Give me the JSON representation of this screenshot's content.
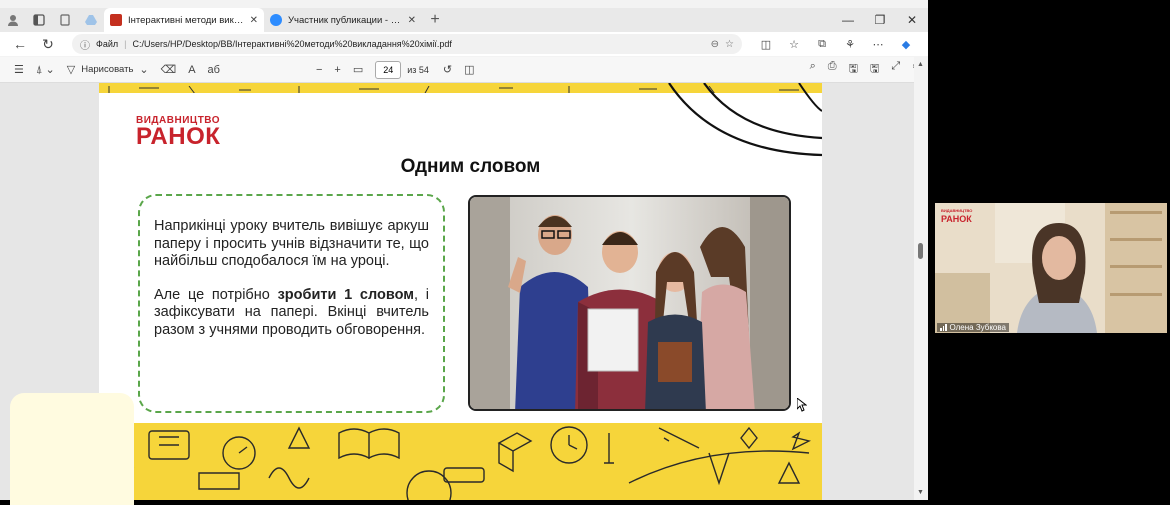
{
  "browser": {
    "tabs": [
      {
        "label": "Інтерактивні методи викладання хімії.pdf",
        "active": true,
        "icon": "pdf-icon"
      },
      {
        "label": "Участник публикации - Zoom",
        "active": false,
        "icon": "zoom-icon"
      }
    ],
    "new_tab": "+",
    "window_controls": {
      "minimize": "—",
      "maximize": "❐",
      "close": "✕"
    },
    "address": {
      "scheme_label": "Файл",
      "url": "C:/Users/HP/Desktop/BB/Інтерактивні%20методи%20викладання%20хімії.pdf"
    }
  },
  "pdf_toolbar": {
    "draw_label": "Нарисовать",
    "aa_label": "A",
    "read_aloud_label": "аб",
    "current_page": "24",
    "page_count_label": "из 54"
  },
  "slide": {
    "publisher_small": "ВИДАВНИЦТВО",
    "publisher_big": "РАНОК",
    "title": "Одним словом",
    "paragraph1": "Наприкінці уроку вчитель вивішує аркуш паперу і просить учнів відзначити те, що найбільш сподобалося їм на уроці.",
    "paragraph2_pre": "Але це потрібно ",
    "paragraph2_bold": "зробити 1 словом",
    "paragraph2_post": ", і зафіксувати на папері. Вкінці вчитель разом з учнями проводить обговорення."
  },
  "video": {
    "participant_name": "Олена Зубкова",
    "background_logo_small": "ВИДАВНИЦТВО",
    "background_logo_big": "РАНОК"
  },
  "colors": {
    "brand_red": "#c8232c",
    "dashed_border": "#5aa64a",
    "doodle_yellow": "#f6d53a"
  }
}
